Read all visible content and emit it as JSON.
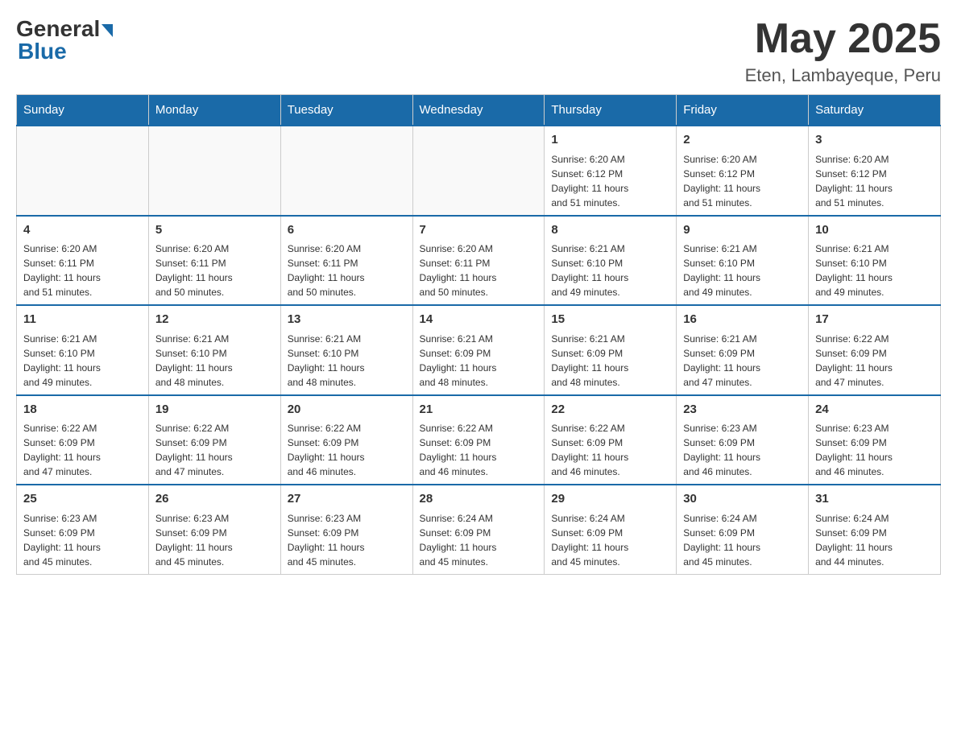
{
  "header": {
    "logo_general": "General",
    "logo_blue": "Blue",
    "month_title": "May 2025",
    "location": "Eten, Lambayeque, Peru"
  },
  "days_of_week": [
    "Sunday",
    "Monday",
    "Tuesday",
    "Wednesday",
    "Thursday",
    "Friday",
    "Saturday"
  ],
  "weeks": [
    [
      {
        "day": "",
        "info": ""
      },
      {
        "day": "",
        "info": ""
      },
      {
        "day": "",
        "info": ""
      },
      {
        "day": "",
        "info": ""
      },
      {
        "day": "1",
        "info": "Sunrise: 6:20 AM\nSunset: 6:12 PM\nDaylight: 11 hours\nand 51 minutes."
      },
      {
        "day": "2",
        "info": "Sunrise: 6:20 AM\nSunset: 6:12 PM\nDaylight: 11 hours\nand 51 minutes."
      },
      {
        "day": "3",
        "info": "Sunrise: 6:20 AM\nSunset: 6:12 PM\nDaylight: 11 hours\nand 51 minutes."
      }
    ],
    [
      {
        "day": "4",
        "info": "Sunrise: 6:20 AM\nSunset: 6:11 PM\nDaylight: 11 hours\nand 51 minutes."
      },
      {
        "day": "5",
        "info": "Sunrise: 6:20 AM\nSunset: 6:11 PM\nDaylight: 11 hours\nand 50 minutes."
      },
      {
        "day": "6",
        "info": "Sunrise: 6:20 AM\nSunset: 6:11 PM\nDaylight: 11 hours\nand 50 minutes."
      },
      {
        "day": "7",
        "info": "Sunrise: 6:20 AM\nSunset: 6:11 PM\nDaylight: 11 hours\nand 50 minutes."
      },
      {
        "day": "8",
        "info": "Sunrise: 6:21 AM\nSunset: 6:10 PM\nDaylight: 11 hours\nand 49 minutes."
      },
      {
        "day": "9",
        "info": "Sunrise: 6:21 AM\nSunset: 6:10 PM\nDaylight: 11 hours\nand 49 minutes."
      },
      {
        "day": "10",
        "info": "Sunrise: 6:21 AM\nSunset: 6:10 PM\nDaylight: 11 hours\nand 49 minutes."
      }
    ],
    [
      {
        "day": "11",
        "info": "Sunrise: 6:21 AM\nSunset: 6:10 PM\nDaylight: 11 hours\nand 49 minutes."
      },
      {
        "day": "12",
        "info": "Sunrise: 6:21 AM\nSunset: 6:10 PM\nDaylight: 11 hours\nand 48 minutes."
      },
      {
        "day": "13",
        "info": "Sunrise: 6:21 AM\nSunset: 6:10 PM\nDaylight: 11 hours\nand 48 minutes."
      },
      {
        "day": "14",
        "info": "Sunrise: 6:21 AM\nSunset: 6:09 PM\nDaylight: 11 hours\nand 48 minutes."
      },
      {
        "day": "15",
        "info": "Sunrise: 6:21 AM\nSunset: 6:09 PM\nDaylight: 11 hours\nand 48 minutes."
      },
      {
        "day": "16",
        "info": "Sunrise: 6:21 AM\nSunset: 6:09 PM\nDaylight: 11 hours\nand 47 minutes."
      },
      {
        "day": "17",
        "info": "Sunrise: 6:22 AM\nSunset: 6:09 PM\nDaylight: 11 hours\nand 47 minutes."
      }
    ],
    [
      {
        "day": "18",
        "info": "Sunrise: 6:22 AM\nSunset: 6:09 PM\nDaylight: 11 hours\nand 47 minutes."
      },
      {
        "day": "19",
        "info": "Sunrise: 6:22 AM\nSunset: 6:09 PM\nDaylight: 11 hours\nand 47 minutes."
      },
      {
        "day": "20",
        "info": "Sunrise: 6:22 AM\nSunset: 6:09 PM\nDaylight: 11 hours\nand 46 minutes."
      },
      {
        "day": "21",
        "info": "Sunrise: 6:22 AM\nSunset: 6:09 PM\nDaylight: 11 hours\nand 46 minutes."
      },
      {
        "day": "22",
        "info": "Sunrise: 6:22 AM\nSunset: 6:09 PM\nDaylight: 11 hours\nand 46 minutes."
      },
      {
        "day": "23",
        "info": "Sunrise: 6:23 AM\nSunset: 6:09 PM\nDaylight: 11 hours\nand 46 minutes."
      },
      {
        "day": "24",
        "info": "Sunrise: 6:23 AM\nSunset: 6:09 PM\nDaylight: 11 hours\nand 46 minutes."
      }
    ],
    [
      {
        "day": "25",
        "info": "Sunrise: 6:23 AM\nSunset: 6:09 PM\nDaylight: 11 hours\nand 45 minutes."
      },
      {
        "day": "26",
        "info": "Sunrise: 6:23 AM\nSunset: 6:09 PM\nDaylight: 11 hours\nand 45 minutes."
      },
      {
        "day": "27",
        "info": "Sunrise: 6:23 AM\nSunset: 6:09 PM\nDaylight: 11 hours\nand 45 minutes."
      },
      {
        "day": "28",
        "info": "Sunrise: 6:24 AM\nSunset: 6:09 PM\nDaylight: 11 hours\nand 45 minutes."
      },
      {
        "day": "29",
        "info": "Sunrise: 6:24 AM\nSunset: 6:09 PM\nDaylight: 11 hours\nand 45 minutes."
      },
      {
        "day": "30",
        "info": "Sunrise: 6:24 AM\nSunset: 6:09 PM\nDaylight: 11 hours\nand 45 minutes."
      },
      {
        "day": "31",
        "info": "Sunrise: 6:24 AM\nSunset: 6:09 PM\nDaylight: 11 hours\nand 44 minutes."
      }
    ]
  ]
}
